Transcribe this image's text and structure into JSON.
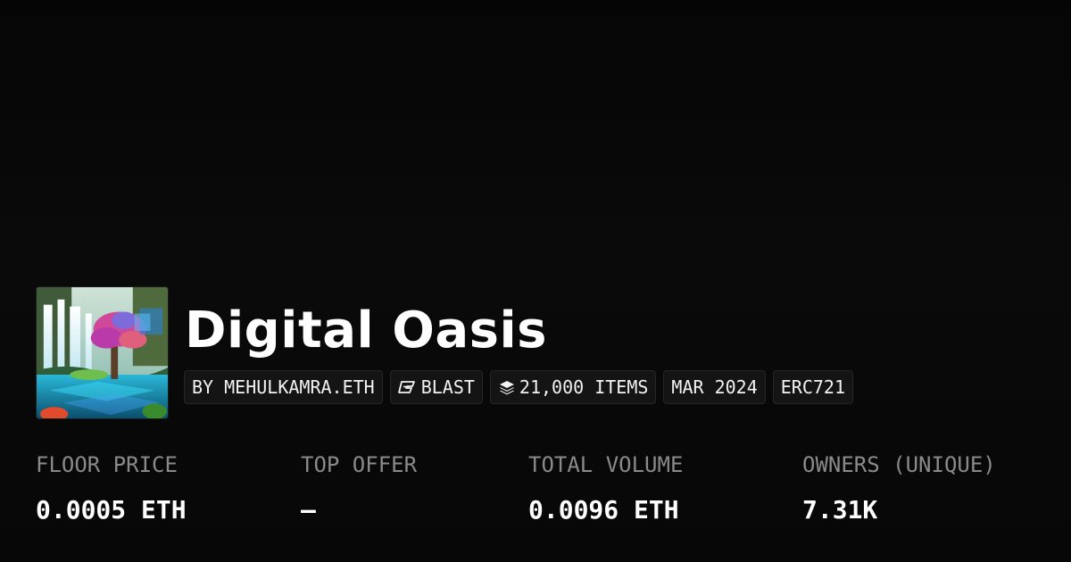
{
  "collection": {
    "name": "Digital Oasis"
  },
  "tags": [
    {
      "label": "BY MEHULKAMRA.ETH",
      "icon": null
    },
    {
      "label": "BLAST",
      "icon": "blast-logo-icon"
    },
    {
      "label": "21,000 ITEMS",
      "icon": "layers-icon"
    },
    {
      "label": "MAR 2024",
      "icon": null
    },
    {
      "label": "ERC721",
      "icon": null
    }
  ],
  "stats": [
    {
      "label": "FLOOR PRICE",
      "value": "0.0005 ETH"
    },
    {
      "label": "TOP OFFER",
      "value": "—"
    },
    {
      "label": "TOTAL VOLUME",
      "value": "0.0096 ETH"
    },
    {
      "label": "OWNERS (UNIQUE)",
      "value": "7.31K"
    }
  ],
  "colors": {
    "background": "#0a0a0a",
    "pill_background": "#141414",
    "pill_border": "#262626",
    "label_gray": "#8a8a8a",
    "text": "#ffffff"
  }
}
